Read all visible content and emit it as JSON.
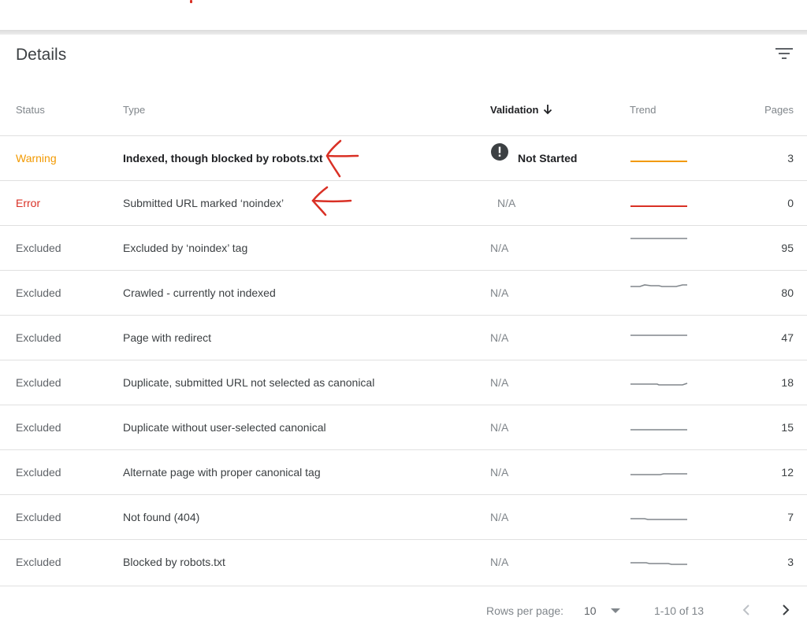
{
  "card": {
    "title": "Details",
    "columns": {
      "status": "Status",
      "type": "Type",
      "validation": "Validation",
      "trend": "Trend",
      "pages": "Pages"
    }
  },
  "rows": [
    {
      "status": "Warning",
      "status_color": "#f29900",
      "type": "Indexed, though blocked by robots.txt",
      "validation": "Not Started",
      "pages": "3",
      "trend_color": "#f29900"
    },
    {
      "status": "Error",
      "status_color": "#d93025",
      "type": "Submitted URL marked ‘noindex’",
      "validation": "N/A",
      "pages": "0",
      "trend_color": "#d93025"
    },
    {
      "status": "Excluded",
      "status_color": "#5f6368",
      "type": "Excluded by ‘noindex’ tag",
      "validation": "N/A",
      "pages": "95",
      "trend_color": "#80868b"
    },
    {
      "status": "Excluded",
      "status_color": "#5f6368",
      "type": "Crawled - currently not indexed",
      "validation": "N/A",
      "pages": "80",
      "trend_color": "#80868b"
    },
    {
      "status": "Excluded",
      "status_color": "#5f6368",
      "type": "Page with redirect",
      "validation": "N/A",
      "pages": "47",
      "trend_color": "#80868b"
    },
    {
      "status": "Excluded",
      "status_color": "#5f6368",
      "type": "Duplicate, submitted URL not selected as canonical",
      "validation": "N/A",
      "pages": "18",
      "trend_color": "#80868b"
    },
    {
      "status": "Excluded",
      "status_color": "#5f6368",
      "type": "Duplicate without user-selected canonical",
      "validation": "N/A",
      "pages": "15",
      "trend_color": "#80868b"
    },
    {
      "status": "Excluded",
      "status_color": "#5f6368",
      "type": "Alternate page with proper canonical tag",
      "validation": "N/A",
      "pages": "12",
      "trend_color": "#80868b"
    },
    {
      "status": "Excluded",
      "status_color": "#5f6368",
      "type": "Not found (404)",
      "validation": "N/A",
      "pages": "7",
      "trend_color": "#80868b"
    },
    {
      "status": "Excluded",
      "status_color": "#5f6368",
      "type": "Blocked by robots.txt",
      "validation": "N/A",
      "pages": "3",
      "trend_color": "#80868b"
    }
  ],
  "pagination": {
    "rows_per_page_label": "Rows per page:",
    "rows_per_page_value": "10",
    "range": "1-10 of 13"
  },
  "icons": {
    "filter": "filter-icon",
    "sort_arrow": "arrow-down-icon",
    "validation_badge": "exclamation-circle-icon",
    "prev": "chevron-left-icon",
    "next": "chevron-right-icon"
  },
  "colors": {
    "warning": "#f29900",
    "error": "#d93025",
    "annotation": "#d93025"
  }
}
